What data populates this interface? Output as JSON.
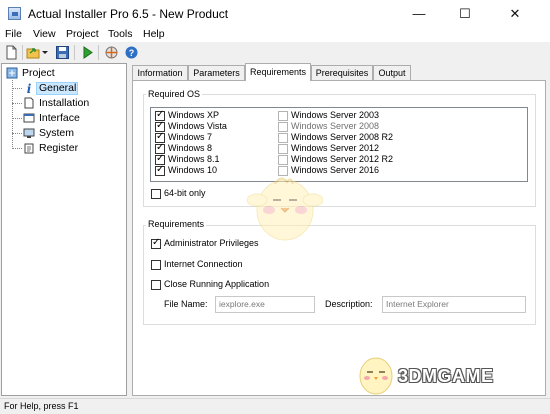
{
  "window": {
    "title": "Actual Installer Pro 6.5 - New Product"
  },
  "menu": [
    "File",
    "View",
    "Project",
    "Tools",
    "Help"
  ],
  "toolbar_icons": [
    "new-file-icon",
    "open-folder-icon",
    "dropdown-arrow-icon",
    "save-icon",
    "build-run-icon",
    "build-icon",
    "help-icon"
  ],
  "tree": {
    "root": "Project",
    "items": [
      "General",
      "Installation",
      "Interface",
      "System",
      "Register"
    ],
    "selected": "General"
  },
  "tabs": [
    "Information",
    "Parameters",
    "Requirements",
    "Prerequisites",
    "Output"
  ],
  "active_tab": "Requirements",
  "required_os": {
    "title": "Required OS",
    "left": [
      {
        "label": "Windows XP",
        "checked": true
      },
      {
        "label": "Windows Vista",
        "checked": true
      },
      {
        "label": "Windows 7",
        "checked": true
      },
      {
        "label": "Windows 8",
        "checked": true
      },
      {
        "label": "Windows 8.1",
        "checked": true
      },
      {
        "label": "Windows 10",
        "checked": true
      }
    ],
    "right": [
      {
        "label": "Windows Server 2003",
        "checked": false
      },
      {
        "label": "Windows Server 2008",
        "checked": false
      },
      {
        "label": "Windows Server 2008 R2",
        "checked": false
      },
      {
        "label": "Windows Server 2012",
        "checked": false
      },
      {
        "label": "Windows Server 2012 R2",
        "checked": false
      },
      {
        "label": "Windows Server 2016",
        "checked": false
      }
    ],
    "bit64": {
      "label": "64-bit only",
      "checked": false
    }
  },
  "requirements": {
    "title": "Requirements",
    "admin": {
      "label": "Administrator Privileges",
      "checked": true
    },
    "internet": {
      "label": "Internet Connection",
      "checked": false
    },
    "close_app": {
      "label": "Close Running Application",
      "checked": false
    },
    "file_name_label": "File Name:",
    "file_name_value": "iexplore.exe",
    "description_label": "Description:",
    "description_value": "Internet Explorer"
  },
  "status": "For Help, press F1",
  "watermark": "3DMGAME"
}
